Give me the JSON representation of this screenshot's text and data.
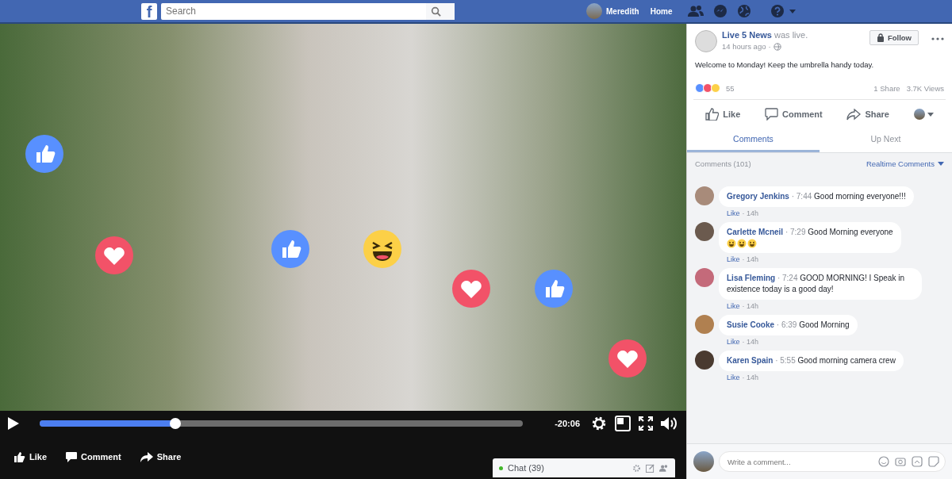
{
  "topbar": {
    "logo": "f",
    "search": {
      "placeholder": "Search"
    },
    "user": "Meredith",
    "home": "Home"
  },
  "video": {
    "reactions": [
      {
        "kind": "like"
      },
      {
        "kind": "love"
      },
      {
        "kind": "like"
      },
      {
        "kind": "haha"
      },
      {
        "kind": "love"
      },
      {
        "kind": "like"
      },
      {
        "kind": "love"
      }
    ],
    "progress": {
      "level": 0.28
    },
    "time": "-20:06",
    "actions": [
      "Like",
      "Comment",
      "Share"
    ],
    "chat": {
      "label": "Chat (39)",
      "online": true
    }
  },
  "post": {
    "page": "Live 5 News",
    "status": "was live.",
    "time": "14 hours ago",
    "time_separator": "·",
    "follow": "Follow",
    "text": "Welcome to Monday! Keep the umbrella handy today.",
    "reaction_count": "55",
    "shares": "1 Share",
    "views": "3.7K Views",
    "actions": [
      "Like",
      "Comment",
      "Share"
    ],
    "tabs": [
      {
        "label": "Comments",
        "selected": true
      },
      {
        "label": "Up Next",
        "selected": false
      }
    ],
    "comments_count": "Comments (101)",
    "sort": "Realtime Comments",
    "comments": [
      {
        "name": "Gregory Jenkins",
        "time": "· 7:44",
        "text": "Good morning everyone!!!",
        "emoji": false,
        "like": "Like",
        "age": "· 14h"
      },
      {
        "name": "Carlette Mcneil",
        "time": "· 7:29",
        "text": "Good Morning everyone",
        "emoji": true,
        "like": "Like",
        "age": "· 14h"
      },
      {
        "name": "Lisa Fleming",
        "time": "· 7:24",
        "text": "GOOD MORNING! I Speak in existence today is a good day!",
        "emoji": false,
        "like": "Like",
        "age": "· 14h"
      },
      {
        "name": "Susie Cooke",
        "time": "· 6:39",
        "text": "Good Morning",
        "emoji": false,
        "like": "Like",
        "age": "· 14h"
      },
      {
        "name": "Karen Spain",
        "time": "· 5:55",
        "text": "Good morning camera crew",
        "emoji": false,
        "like": "Like",
        "age": "· 14h"
      }
    ],
    "write": {
      "placeholder": "Write a comment..."
    }
  }
}
